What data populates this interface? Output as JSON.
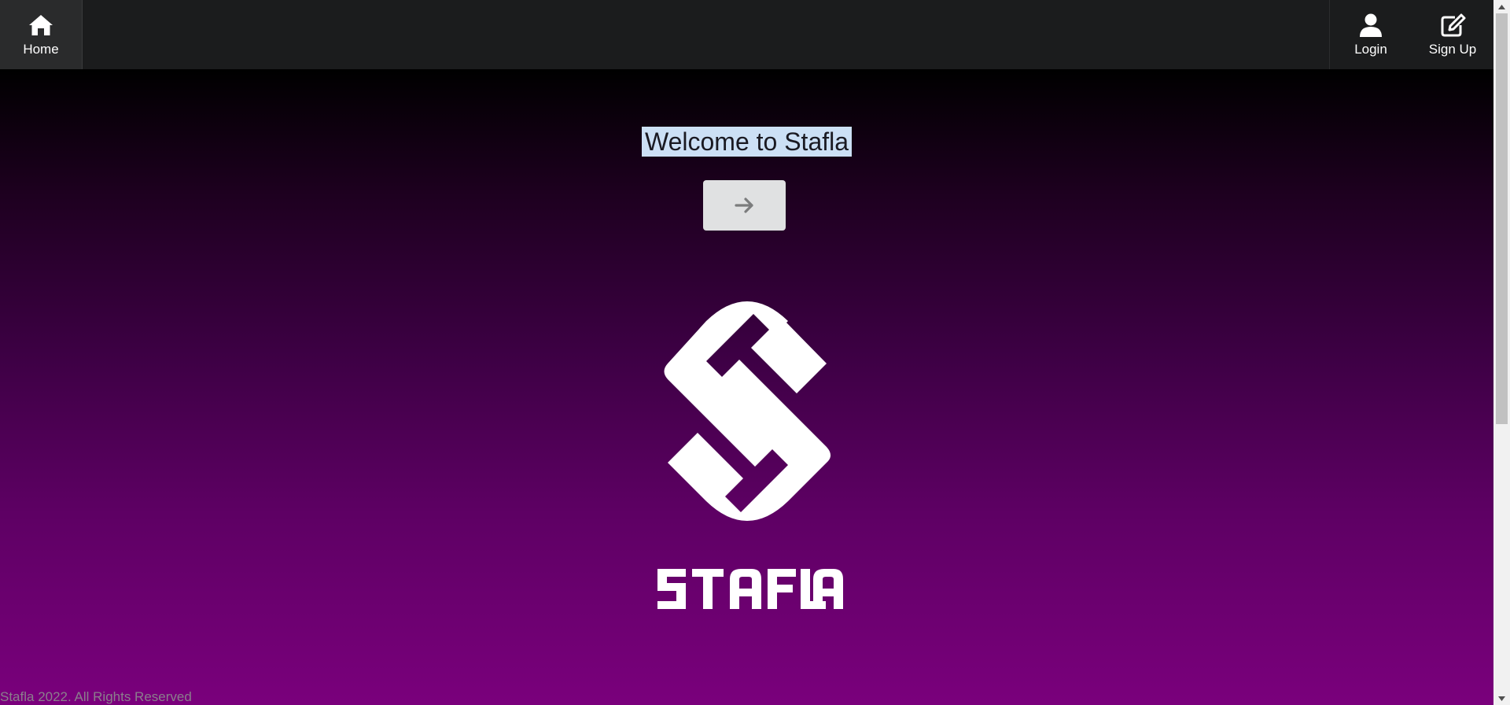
{
  "nav": {
    "home": {
      "label": "Home",
      "icon": "home-icon"
    },
    "login": {
      "label": "Login",
      "icon": "user-icon"
    },
    "signup": {
      "label": "Sign Up",
      "icon": "edit-icon"
    }
  },
  "hero": {
    "welcome_text": "Welcome to Stafla",
    "enter_button_icon": "arrow-right-icon",
    "logo_text": "STAFLA"
  },
  "footer": {
    "text": "Stafla 2022. All Rights Reserved"
  },
  "colors": {
    "navbar": "#1b1c1d",
    "gradient_top": "#000000",
    "gradient_bottom": "#7a007c",
    "button": "#e0e1e2",
    "selection": "#cce0f5"
  }
}
